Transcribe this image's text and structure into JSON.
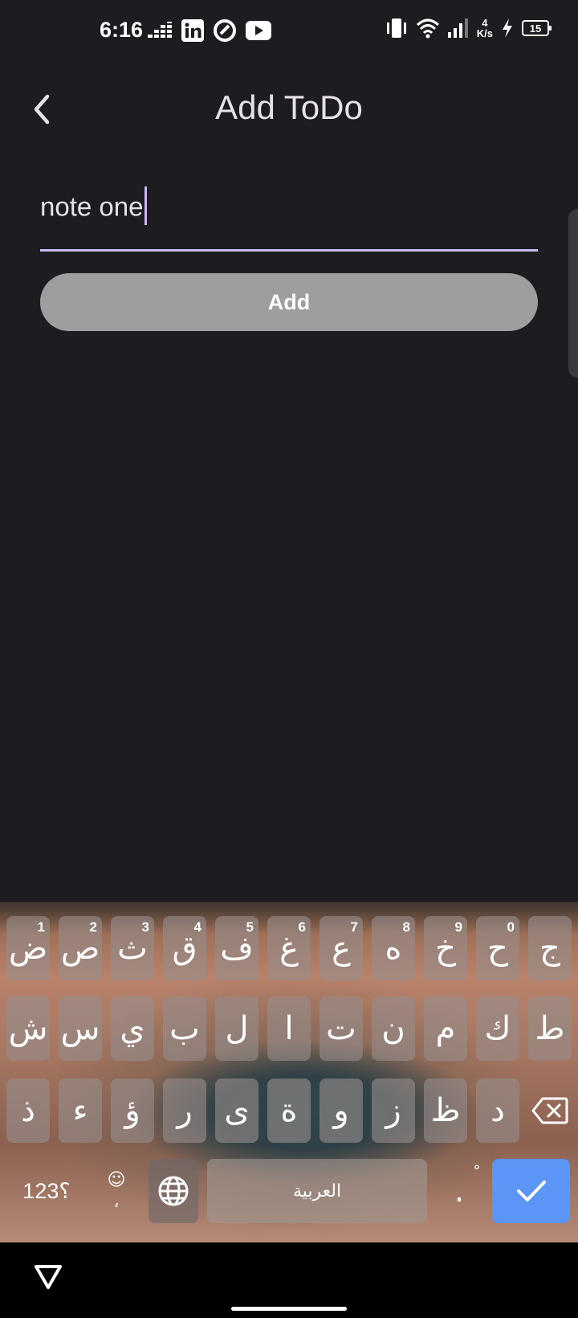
{
  "status_bar": {
    "time": "6:16",
    "net_speed_value": "4",
    "net_speed_unit": "K/s",
    "battery": "15",
    "icons": [
      "deezer-icon",
      "linkedin-icon",
      "threads-icon",
      "youtube-icon",
      "vibrate-icon",
      "wifi-icon",
      "signal-icon",
      "charging-icon",
      "battery-icon"
    ]
  },
  "app_bar": {
    "title": "Add ToDo",
    "back_icon": "chevron-left-icon"
  },
  "form": {
    "input_value": "note one",
    "add_label": "Add"
  },
  "keyboard": {
    "row1": [
      {
        "char": "ض",
        "hint": "1"
      },
      {
        "char": "ص",
        "hint": "2"
      },
      {
        "char": "ث",
        "hint": "3"
      },
      {
        "char": "ق",
        "hint": "4"
      },
      {
        "char": "ف",
        "hint": "5"
      },
      {
        "char": "غ",
        "hint": "6"
      },
      {
        "char": "ع",
        "hint": "7"
      },
      {
        "char": "ه",
        "hint": "8"
      },
      {
        "char": "خ",
        "hint": "9"
      },
      {
        "char": "ح",
        "hint": "0"
      },
      {
        "char": "ج",
        "hint": ""
      }
    ],
    "row2": [
      "ش",
      "س",
      "ي",
      "ب",
      "ل",
      "ا",
      "ت",
      "ن",
      "م",
      "ك",
      "ط"
    ],
    "row3": [
      "ذ",
      "ء",
      "ؤ",
      "ر",
      "ى",
      "ة",
      "و",
      "ز",
      "ظ",
      "د"
    ],
    "symbols_label": "؟123",
    "comma_label": "،",
    "emoji_symbol": "☺",
    "space_label": "العربية",
    "period_label": ".",
    "harakat_symbol": "ْ",
    "backspace_icon": "backspace-icon",
    "language_icon": "globe-icon",
    "enter_icon": "check-icon"
  },
  "colors": {
    "background": "#1d1c21",
    "accent": "#cbb8ee",
    "button": "#9e9e9e",
    "enter_key": "#5b95f5"
  }
}
